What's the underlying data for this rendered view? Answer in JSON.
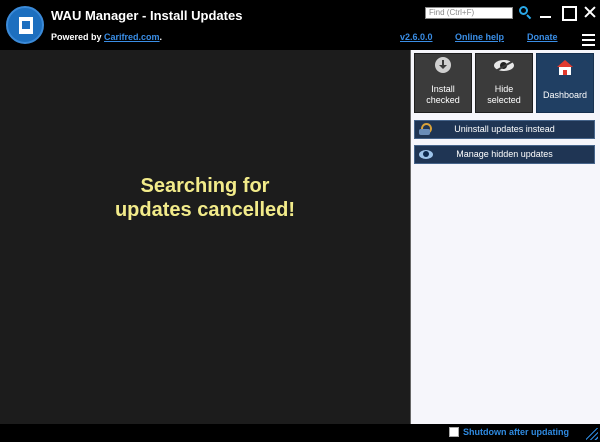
{
  "titlebar": {
    "title": "WAU Manager - Install Updates",
    "powered_by_prefix": "Powered by ",
    "powered_by_link": "Carifred.com",
    "powered_by_suffix": ".",
    "find_placeholder": "Find (Ctrl+F)",
    "version_link": "v2.6.0.0",
    "help_link": "Online help",
    "donate_link": "Donate",
    "icons": [
      "app-logo-icon",
      "search-icon",
      "minimize-icon",
      "maximize-icon",
      "close-icon",
      "hamburger-menu-icon"
    ]
  },
  "main": {
    "status_line1": "Searching for",
    "status_line2": "updates cancelled!"
  },
  "side_panel": {
    "tiles": [
      {
        "line1": "Install",
        "line2": "checked",
        "icon": "download-icon"
      },
      {
        "line1": "Hide",
        "line2": "selected",
        "icon": "eye-slash-icon"
      },
      {
        "line1": "Dashboard",
        "icon": "home-icon"
      }
    ],
    "uninstall_label": "Uninstall updates instead",
    "manage_hidden_label": "Manage hidden updates"
  },
  "footer": {
    "shutdown_label": "Shutdown after updating",
    "shutdown_checked": false
  },
  "colors": {
    "background": "#000000",
    "main_area": "#1c1c1c",
    "status_text": "#f2eb8a",
    "link": "#3a8ee6",
    "tile": "#3b3b3b",
    "dashboard_tile": "#203f63",
    "wide_button": "#1f3554",
    "side_panel": "#f6f6fb"
  }
}
